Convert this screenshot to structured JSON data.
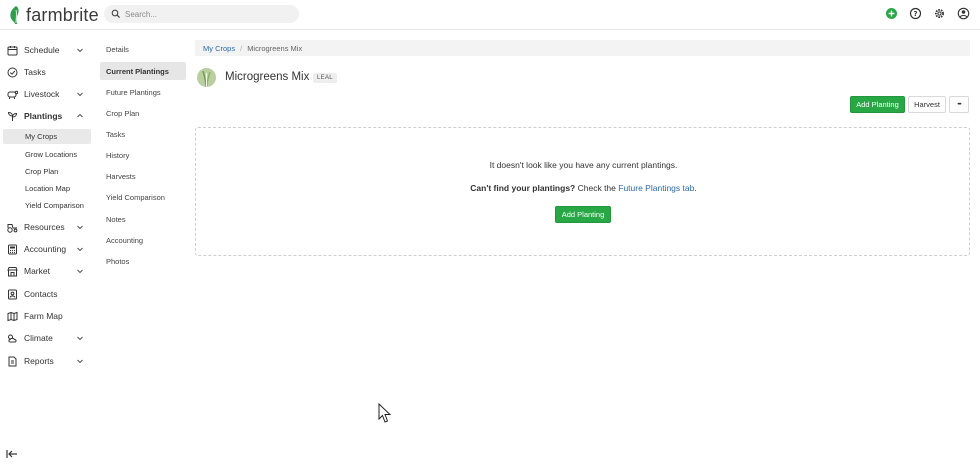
{
  "app": {
    "logo_text": "farmbrite"
  },
  "search": {
    "placeholder": "Search..."
  },
  "top_icons": [
    "add-circle-icon",
    "help-icon",
    "settings-icon",
    "user-icon"
  ],
  "colors": {
    "brand_green": "#28a745",
    "link_blue": "#2a6aa8",
    "active_bg": "#e9e9e9"
  },
  "leftnav": {
    "schedule": "Schedule",
    "tasks": "Tasks",
    "livestock": "Livestock",
    "plantings": "Plantings",
    "plantings_sub": [
      "My Crops",
      "Grow Locations",
      "Crop Plan",
      "Location Map",
      "Yield Comparison"
    ],
    "resources": "Resources",
    "accounting": "Accounting",
    "market": "Market",
    "contacts": "Contacts",
    "farm_map": "Farm Map",
    "climate": "Climate",
    "reports": "Reports"
  },
  "subnav": [
    "Details",
    "Current Plantings",
    "Future Plantings",
    "Crop Plan",
    "Tasks",
    "History",
    "Harvests",
    "Yield Comparison",
    "Notes",
    "Accounting",
    "Photos"
  ],
  "breadcrumb": {
    "root": "My Crops",
    "separator": "/",
    "current": "Microgreens Mix"
  },
  "crop": {
    "name": "Microgreens Mix",
    "badge": "LEAL"
  },
  "actions": {
    "add_planting": "Add Planting",
    "harvest": "Harvest",
    "more": "•••"
  },
  "empty": {
    "line1": "It doesn't look like you have any current plantings.",
    "line2_bold": "Can't find your plantings?",
    "line2_text": " Check the ",
    "line2_link": "Future Plantings tab",
    "line2_end": ".",
    "button": "Add Planting"
  }
}
